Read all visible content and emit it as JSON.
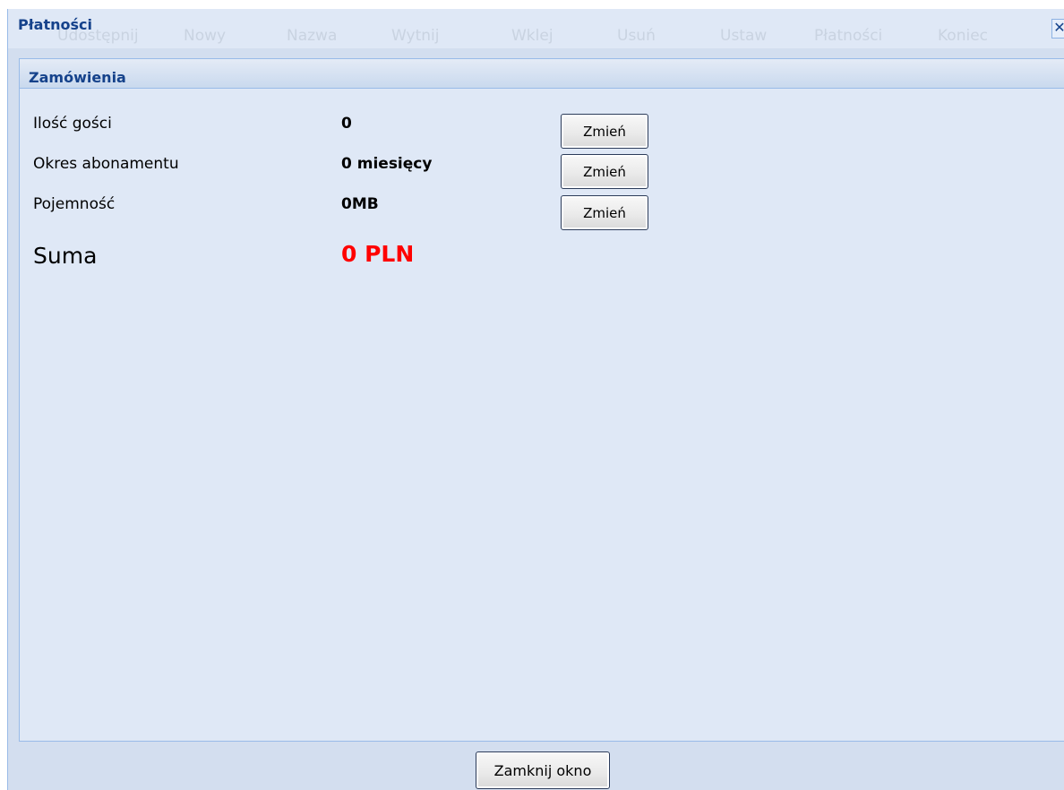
{
  "window": {
    "title": "Płatności",
    "close_glyph": "✕",
    "background_toolbar": [
      "Udostępnij",
      "Nowy",
      "Nazwa",
      "Wytnij",
      "Wklej",
      "Usuń",
      "Ustaw",
      "Płatności",
      "Koniec"
    ]
  },
  "panel": {
    "title": "Zamówienia",
    "rows": [
      {
        "label": "Ilość gości",
        "value": "0",
        "button": "Zmień"
      },
      {
        "label": "Okres abonamentu",
        "value": "0 miesięcy",
        "button": "Zmień"
      },
      {
        "label": "Pojemność",
        "value": "0MB",
        "button": "Zmień"
      }
    ],
    "sum_label": "Suma",
    "sum_value": "0 PLN"
  },
  "footer": {
    "close_button": "Zamknij okno"
  },
  "colors": {
    "title_text": "#15428b",
    "sum_value": "#ff0000",
    "panel_bg": "#dfe8f6",
    "window_bg": "#d3deef"
  }
}
